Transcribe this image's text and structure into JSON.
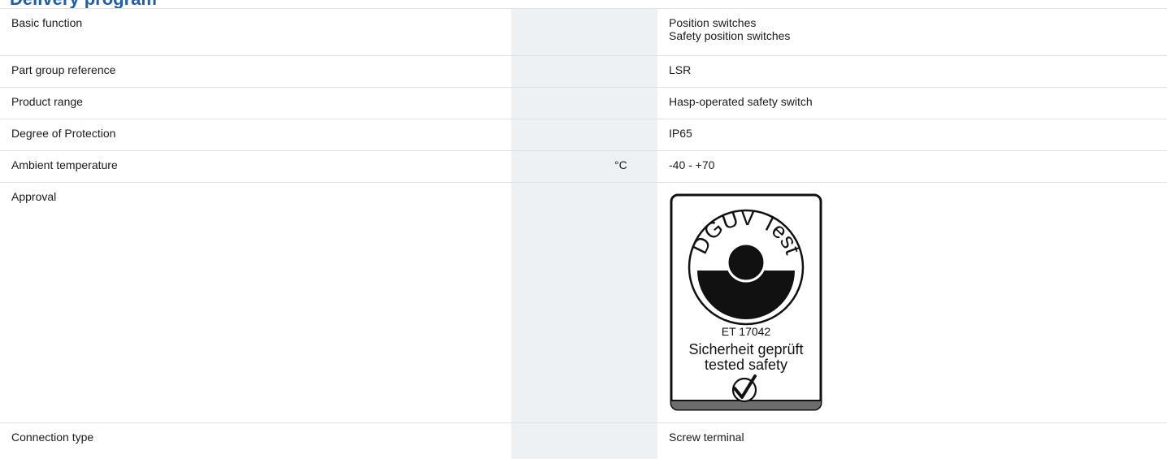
{
  "heading": "Delivery program",
  "rows": [
    {
      "label": "Basic function",
      "unit": "",
      "value_lines": [
        "Position switches",
        "Safety position switches"
      ]
    },
    {
      "label": "Part group reference",
      "unit": "",
      "value": "LSR"
    },
    {
      "label": "Product range",
      "unit": "",
      "value": "Hasp-operated safety switch"
    },
    {
      "label": "Degree of Protection",
      "unit": "",
      "value": "IP65"
    },
    {
      "label": "Ambient temperature",
      "unit": "°C",
      "value": "-40 - +70"
    },
    {
      "label": "Approval",
      "unit": "",
      "value": ""
    },
    {
      "label": "Connection type",
      "unit": "",
      "value": "Screw terminal"
    }
  ],
  "approval_badge": {
    "icon": "dguv-test-certification-icon",
    "arc_text": "DGUV Test",
    "cert_number": "ET 17042",
    "line_de": "Sicherheit geprüft",
    "line_en": "tested safety"
  }
}
